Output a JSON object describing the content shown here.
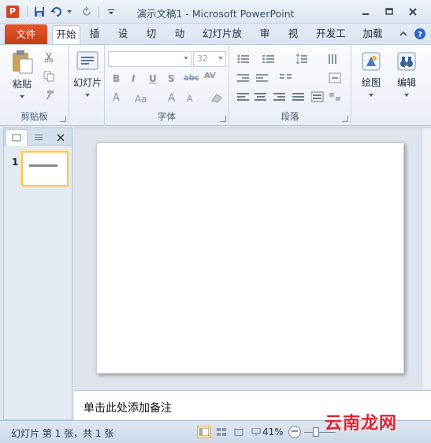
{
  "titlebar": {
    "app_icon_letter": "P",
    "title": "演示文稿1 - Microsoft PowerPoint",
    "qat_icons": [
      "save-icon",
      "undo-icon",
      "redo-icon",
      "customize-qat-icon"
    ],
    "window_controls": [
      "minimize-icon",
      "restore-icon",
      "close-icon"
    ]
  },
  "tabs": {
    "file_label": "文件",
    "items": [
      "开始",
      "插入",
      "设计",
      "切换",
      "动画",
      "幻灯片放映",
      "审阅",
      "视图",
      "开发工具",
      "加载项"
    ],
    "active": "开始",
    "right_icons": [
      "collapse-ribbon-icon",
      "help-icon"
    ]
  },
  "ribbon": {
    "clipboard": {
      "label": "剪贴板",
      "paste_label": "粘贴",
      "icons": [
        "paste-icon",
        "cut-icon",
        "copy-icon",
        "format-painter-icon"
      ]
    },
    "slides": {
      "new_slide_label": "幻灯片"
    },
    "font": {
      "label": "字体",
      "font_name": "",
      "font_size": "32",
      "buttons": [
        "B",
        "I",
        "U",
        "S",
        "abc",
        "AV",
        "Aa",
        "A",
        "A"
      ]
    },
    "paragraph": {
      "label": "段落"
    },
    "drawing": {
      "label": "绘图"
    },
    "editing": {
      "label": "编辑"
    }
  },
  "outline_panel": {
    "tabs": [
      "slides-tab-icon",
      "outline-tab-icon",
      "close-pane-icon"
    ],
    "thumb_number": "1"
  },
  "notes": {
    "placeholder": "单击此处添加备注"
  },
  "statusbar": {
    "slide_info": "幻灯片 第 1 张，共 1 张",
    "zoom": "41%",
    "zoom_minus": "−"
  },
  "watermark": "云南龙网",
  "colors": {
    "file_tab": "#d24726",
    "ribbon_bg": "#fbfcfe",
    "selected_thumb_border": "#f4c85a"
  }
}
